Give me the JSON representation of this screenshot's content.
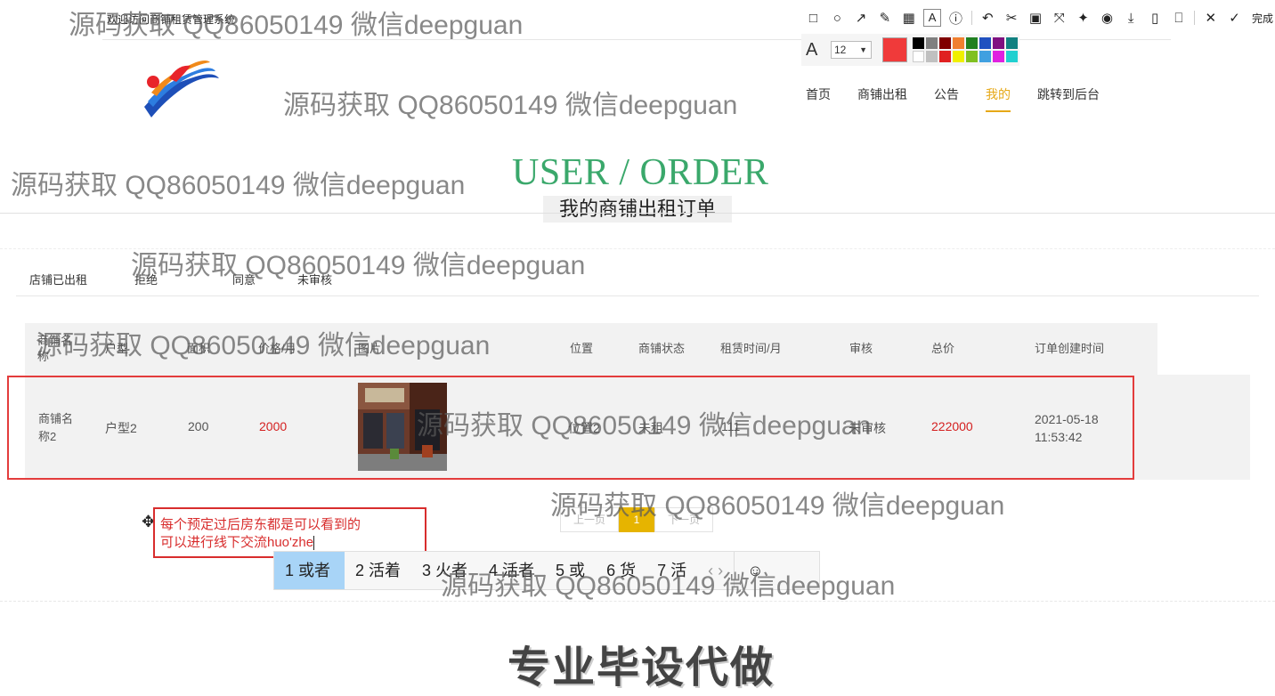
{
  "site": {
    "title": "欢迎访问商铺租赁管理系统"
  },
  "nav": {
    "items": [
      "首页",
      "商铺出租",
      "公告",
      "我的",
      "跳转到后台"
    ],
    "active": "我的"
  },
  "hero": {
    "en": "USER / ORDER",
    "cn": "我的商铺出租订单"
  },
  "tabs": [
    "店铺已出租",
    "拒绝",
    "同意",
    "未审核"
  ],
  "table": {
    "headers": [
      "商铺名称",
      "户型",
      "面积",
      "价格/月",
      "图片",
      "位置",
      "商铺状态",
      "租赁时间/月",
      "审核",
      "总价",
      "订单创建时间"
    ],
    "row": {
      "name": "商铺名称2",
      "type": "户型2",
      "area": "200",
      "price": "2000",
      "location": "位置2",
      "status": "未租",
      "months": "111",
      "review": "未审核",
      "total": "222000",
      "created_date": "2021-05-18",
      "created_time": "11:53:42"
    }
  },
  "pager": {
    "prev": "上一页",
    "page": "1",
    "next": "下一页"
  },
  "annotation": {
    "line1": "每个预定过后房东都是可以看到的",
    "line2": "可以进行线下交流huo'zhe"
  },
  "ime": {
    "candidates": [
      "1 或者",
      "2 活着",
      "3 火者",
      "4 活者",
      "5 或",
      "6 货",
      "7 活"
    ],
    "arrows": "‹  ›",
    "emoji": "☺"
  },
  "toolbar": {
    "done": "完成",
    "font_size": "12",
    "current_color": "#f03a3a",
    "palette": [
      "#000000",
      "#808080",
      "#800000",
      "#f08030",
      "#208020",
      "#2050c0",
      "#801080",
      "#108080",
      "#ffffff",
      "#c0c0c0",
      "#e02020",
      "#f0f000",
      "#80c020",
      "#40a0e0",
      "#e020e0",
      "#20d0d0"
    ]
  },
  "watermark": "源码获取 QQ86050149 微信deepguan",
  "footer_title": "专业毕设代做"
}
